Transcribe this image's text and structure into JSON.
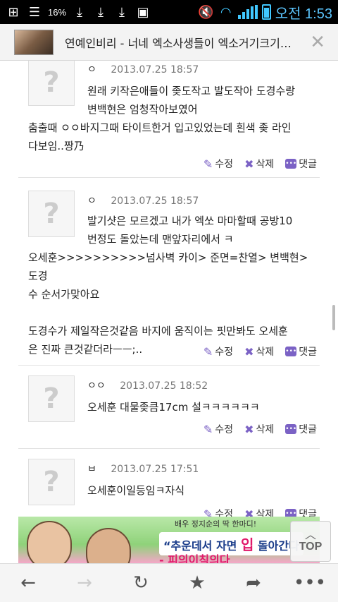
{
  "statusbar": {
    "battery_percent": "16%",
    "time": "오전 1:53"
  },
  "tab": {
    "title": "연예인비리 - 너네 엑소사생들이 엑소거기크기비..."
  },
  "comments": [
    {
      "nick": "ㅇ",
      "date": "2013.07.25 18:57",
      "lines": [
        "원래 키작은애들이 좆도작고 발도작아 도경수랑",
        "변백현은 엄청작아보였어",
        "춤출때 ㅇㅇ바지그때 타이트한거 입고있었는데 흰색 좆 라인",
        "다보임..짱乃"
      ]
    },
    {
      "nick": "ㅇ",
      "date": "2013.07.25 18:57",
      "lines": [
        "발기샷은 모르겠고 내가 엑쏘 마마할때 공방10",
        "번정도 돌았는데 맨앞자리에서 ㅋ",
        "오세훈>>>>>>>>>>넘사벽 카이> 준면=찬열> 변백현> 도경",
        "수 순서가맞아요",
        "",
        "도경수가 제일작은것같음 바지에 움직이는 핏만봐도 오세훈",
        "은 진짜 큰것같더라ㅡㅡ;.."
      ]
    },
    {
      "nick": "ㅇㅇ",
      "date": "2013.07.25 18:52",
      "lines": [
        "오세훈 대물좆큼17cm 설ㅋㅋㅋㅋㅋㅋ"
      ]
    },
    {
      "nick": "ㅂ",
      "date": "2013.07.25 17:51",
      "lines": [
        "오세훈이일등임ㅋ자식"
      ]
    }
  ],
  "actions": {
    "edit": "수정",
    "delete": "삭제",
    "reply": "댓글"
  },
  "ad": {
    "line1": "배우 정지순의 딱 한마디!",
    "line2_prefix": "“추운데서 자면 ",
    "line2_em": "입",
    "line2_suffix": " 돌아간다",
    "line3": "- 피의이칙의다"
  },
  "top_button": {
    "label": "TOP",
    "arrow": "︿"
  },
  "icons": {
    "status": [
      "plus-square-icon",
      "stack-icon",
      "download-icon",
      "download-icon",
      "download-icon",
      "image-icon",
      "mute-icon",
      "wifi-icon",
      "signal-icon",
      "battery-icon"
    ],
    "nav": [
      "back-icon",
      "forward-icon",
      "reload-icon",
      "star-icon",
      "share-icon",
      "more-icon"
    ]
  },
  "colors": {
    "accent": "#7b62c5",
    "status_time": "#5cc6ff"
  }
}
